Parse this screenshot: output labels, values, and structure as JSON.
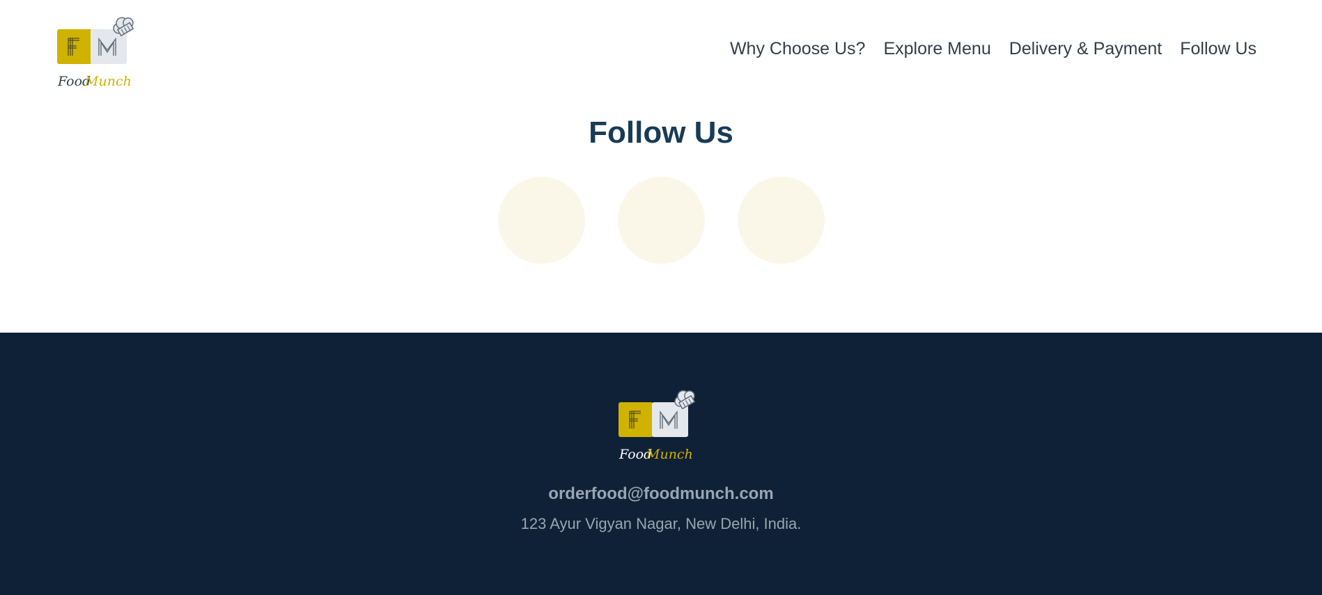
{
  "brand": {
    "logo_letters": [
      "F",
      "M"
    ],
    "wordmark_part1": "Food",
    "wordmark_part2": "Munch",
    "colors": {
      "gold": "#d0b200",
      "light_gray": "#e4e7eb",
      "dark_text": "#323f4b",
      "heading": "#183b56"
    }
  },
  "nav": {
    "links": [
      {
        "label": "Why Choose Us?"
      },
      {
        "label": "Explore Menu"
      },
      {
        "label": "Delivery & Payment"
      },
      {
        "label": "Follow Us"
      }
    ]
  },
  "follow": {
    "heading": "Follow Us",
    "social_icons": [
      "social-icon-1",
      "social-icon-2",
      "social-icon-3"
    ],
    "circle_color": "#faf7e8"
  },
  "footer": {
    "email": "orderfood@foodmunch.com",
    "address": "123 Ayur Vigyan Nagar, New Delhi, India.",
    "background": "#0f2137"
  }
}
